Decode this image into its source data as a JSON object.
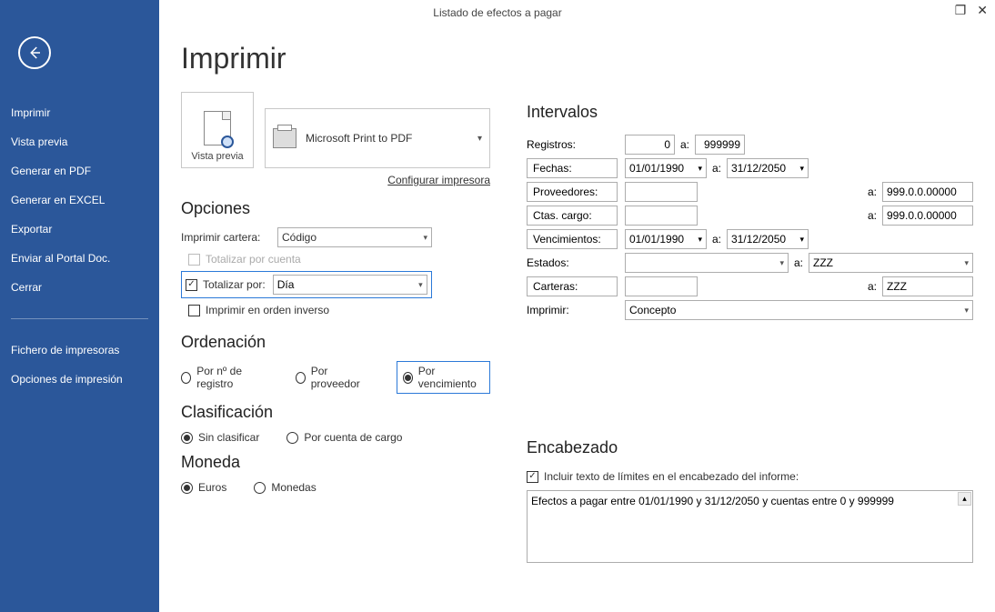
{
  "window": {
    "title": "Listado de efectos a pagar"
  },
  "sidebar": {
    "back": "back",
    "items": [
      "Imprimir",
      "Vista previa",
      "Generar en PDF",
      "Generar en EXCEL",
      "Exportar",
      "Enviar al Portal Doc.",
      "Cerrar"
    ],
    "secondary": [
      "Fichero de impresoras",
      "Opciones de impresión"
    ]
  },
  "page": {
    "title": "Imprimir",
    "preview_caption": "Vista previa",
    "printer_name": "Microsoft Print to PDF",
    "config_link": "Configurar impresora",
    "opciones": {
      "heading": "Opciones",
      "imprimir_cartera_label": "Imprimir cartera:",
      "imprimir_cartera_value": "Código",
      "totalizar_cuenta_label": "Totalizar por cuenta",
      "totalizar_cuenta_checked": false,
      "totalizar_por_label": "Totalizar por:",
      "totalizar_por_checked": true,
      "totalizar_por_value": "Día",
      "orden_inverso_label": "Imprimir en orden inverso",
      "orden_inverso_checked": false
    },
    "ordenacion": {
      "heading": "Ordenación",
      "opt1": "Por nº de registro",
      "opt2": "Por proveedor",
      "opt3": "Por vencimiento",
      "selected": 3
    },
    "clasificacion": {
      "heading": "Clasificación",
      "opt1": "Sin clasificar",
      "opt2": "Por cuenta de cargo",
      "selected": 1
    },
    "moneda": {
      "heading": "Moneda",
      "opt1": "Euros",
      "opt2": "Monedas",
      "selected": 1
    },
    "intervalos": {
      "heading": "Intervalos",
      "a": "a:",
      "registros_label": "Registros:",
      "registros_from": "0",
      "registros_to": "999999",
      "fechas_label": "Fechas:",
      "fechas_from": "01/01/1990",
      "fechas_to": "31/12/2050",
      "proveedores_label": "Proveedores:",
      "proveedores_from": "",
      "proveedores_to": "999.0.0.00000",
      "ctas_label": "Ctas. cargo:",
      "ctas_from": "",
      "ctas_to": "999.0.0.00000",
      "venc_label": "Vencimientos:",
      "venc_from": "01/01/1990",
      "venc_to": "31/12/2050",
      "estados_label": "Estados:",
      "estados_from": "",
      "estados_to": "ZZZ",
      "carteras_label": "Carteras:",
      "carteras_from": "",
      "carteras_to": "ZZZ",
      "imprimir_label": "Imprimir:",
      "imprimir_value": "Concepto"
    },
    "encabezado": {
      "heading": "Encabezado",
      "incluir_label": "Incluir texto de límites en el encabezado del informe:",
      "incluir_checked": true,
      "text": "Efectos a pagar entre 01/01/1990 y 31/12/2050 y cuentas entre 0 y 999999"
    }
  }
}
